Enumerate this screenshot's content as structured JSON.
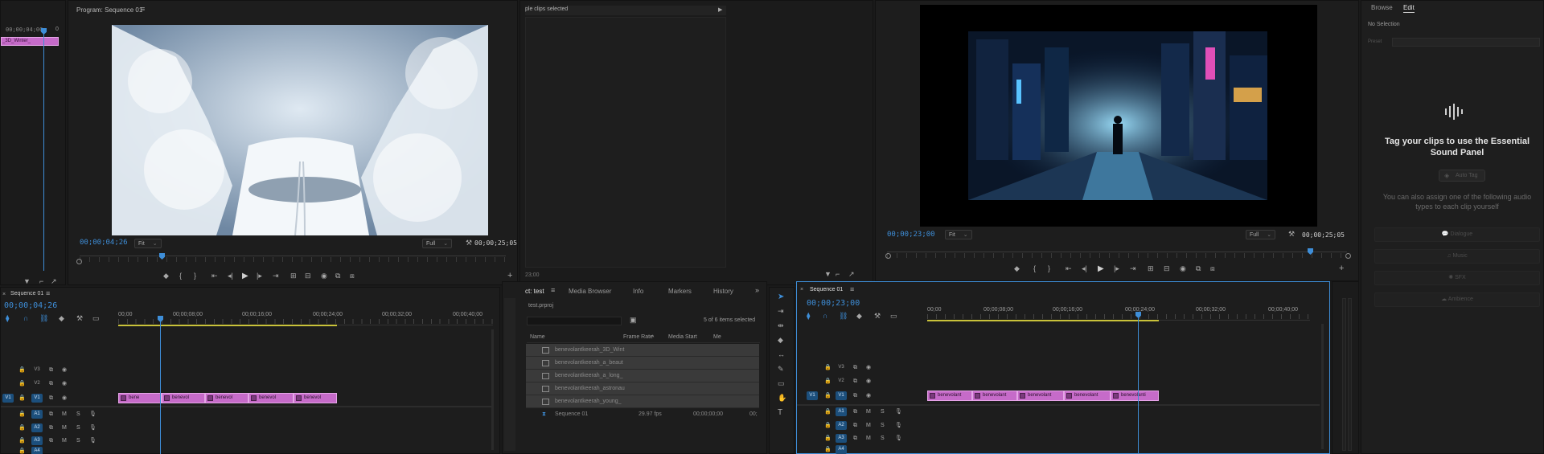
{
  "colors": {
    "accent": "#3e8ed8",
    "clip": "#c66bc9",
    "workarea": "#c9c23a"
  },
  "source_left": {
    "timecode": "00;00;04;00",
    "count": "0",
    "clip_label": "_3D_Winter_"
  },
  "program": {
    "title": "Program: Sequence 01",
    "timecode": "00;00;04;26",
    "fit": "Fit",
    "quality": "Full",
    "duration": "00;00;25;05"
  },
  "info_panel": {
    "header": "ple clips selected",
    "time": "23;00"
  },
  "program2": {
    "timecode": "00;00;23;00",
    "fit": "Fit",
    "quality": "Full",
    "duration": "00;00;25;05"
  },
  "essential_sound": {
    "tabs": [
      "Browse",
      "Edit"
    ],
    "no_selection": "No Selection",
    "preset_label": "Preset",
    "heading": "Tag your clips to use the Essential Sound Panel",
    "auto_tag": "Auto Tag",
    "subtext": "You can also assign one of the following audio types to each clip yourself",
    "types": [
      "Dialogue",
      "Music",
      "SFX",
      "Ambience"
    ]
  },
  "timeline_left": {
    "tab": "Sequence 01",
    "timecode": "00;00;04;26",
    "ruler": [
      "00;00",
      "00;00;08;00",
      "00;00;16;00",
      "00;00;24;00",
      "00;00;32;00",
      "00;00;40;00"
    ],
    "video_tracks": [
      "V3",
      "V2",
      "V1"
    ],
    "audio_tracks": [
      "A1",
      "A2",
      "A3",
      "A4"
    ],
    "target_v": "V1",
    "clips": [
      "bene",
      "benevol",
      "benevol",
      "benevol",
      "benevol"
    ]
  },
  "project": {
    "tabs": [
      "ct: test",
      "Media Browser",
      "Info",
      "Markers",
      "History"
    ],
    "file": "test.prproj",
    "count": "5 of 6 items selected",
    "columns": [
      "Name",
      "Frame Rate",
      "Media Start",
      "Me"
    ],
    "items": [
      "benevolantkeerah_3D_Wint",
      "benevolantkeerah_a_beaut",
      "benevolantkeerah_a_long_",
      "benevolantkeerah_astronau",
      "benevolantkeerah_young_"
    ],
    "sequence": {
      "name": "Sequence 01",
      "fps": "29.97 fps",
      "start": "00;00;00;00",
      "extra": "00;"
    }
  },
  "timeline_right": {
    "tab": "Sequence 01",
    "timecode": "00;00;23;00",
    "ruler": [
      "00;00",
      "00;00;08;00",
      "00;00;16;00",
      "00;00;24;00",
      "00;00;32;00",
      "00;00;40;00"
    ],
    "video_tracks": [
      "V3",
      "V2",
      "V1"
    ],
    "audio_tracks": [
      "A1",
      "A2",
      "A3",
      "A4"
    ],
    "target_v": "V1",
    "clips": [
      "benevolant",
      "benevolant",
      "benevolant",
      "benevolant",
      "benevolanti"
    ]
  }
}
